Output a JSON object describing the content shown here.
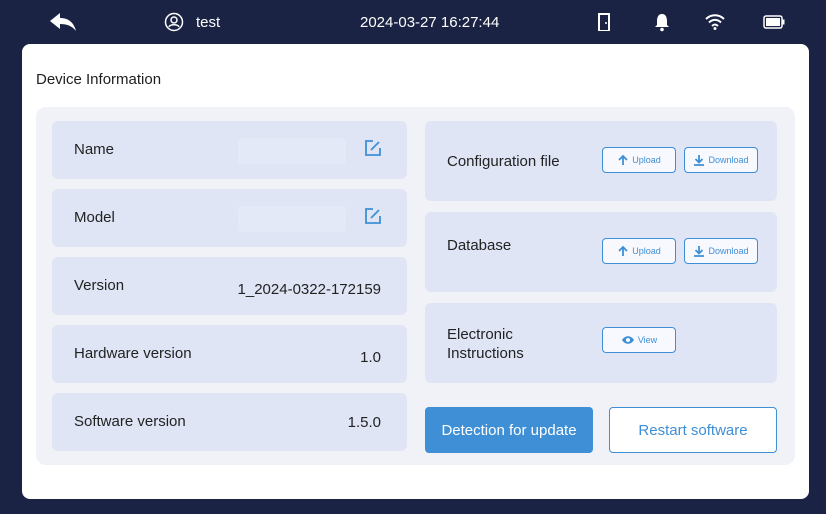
{
  "status_bar": {
    "back_icon": "back-arrow-icon",
    "user_icon": "user-icon",
    "username": "test",
    "datetime": "2024-03-27 16:27:44",
    "icons": [
      "door-icon",
      "bell-icon",
      "wifi-icon",
      "battery-icon"
    ]
  },
  "panel": {
    "title": "Device Information"
  },
  "info": {
    "name_label": "Name",
    "name_value": "",
    "model_label": "Model",
    "model_value": "",
    "version_label": "Version",
    "version_value": "1_2024-0322-172159",
    "hardware_label": "Hardware version",
    "hardware_value": "1.0",
    "software_label": "Software version",
    "software_value": "1.5.0"
  },
  "files": {
    "config_label": "Configuration file",
    "database_label": "Database",
    "instructions_label_line1": "Electronic",
    "instructions_label_line2": "Instructions",
    "upload_label": "Upload",
    "download_label": "Download",
    "view_label": "View"
  },
  "actions": {
    "detect_update_label": "Detection for update",
    "restart_label": "Restart software"
  },
  "colors": {
    "accent": "#3f8fd6",
    "status_bar_bg": "#1a2344",
    "card_bg": "#dfe5f5"
  }
}
